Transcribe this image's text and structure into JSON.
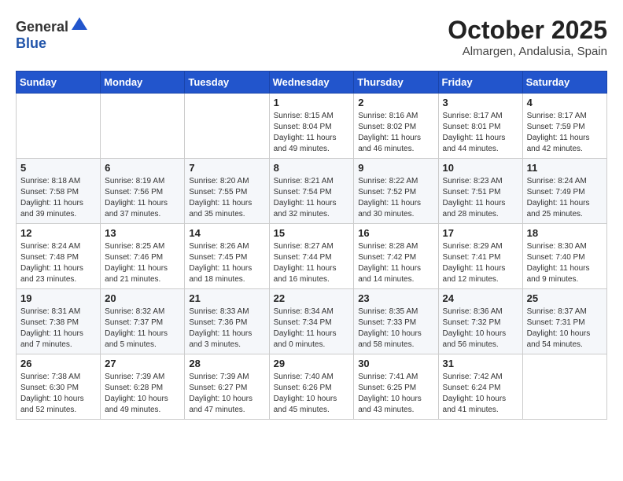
{
  "header": {
    "logo_general": "General",
    "logo_blue": "Blue",
    "month_title": "October 2025",
    "location": "Almargen, Andalusia, Spain"
  },
  "weekdays": [
    "Sunday",
    "Monday",
    "Tuesday",
    "Wednesday",
    "Thursday",
    "Friday",
    "Saturday"
  ],
  "weeks": [
    [
      {
        "day": "",
        "info": ""
      },
      {
        "day": "",
        "info": ""
      },
      {
        "day": "",
        "info": ""
      },
      {
        "day": "1",
        "info": "Sunrise: 8:15 AM\nSunset: 8:04 PM\nDaylight: 11 hours\nand 49 minutes."
      },
      {
        "day": "2",
        "info": "Sunrise: 8:16 AM\nSunset: 8:02 PM\nDaylight: 11 hours\nand 46 minutes."
      },
      {
        "day": "3",
        "info": "Sunrise: 8:17 AM\nSunset: 8:01 PM\nDaylight: 11 hours\nand 44 minutes."
      },
      {
        "day": "4",
        "info": "Sunrise: 8:17 AM\nSunset: 7:59 PM\nDaylight: 11 hours\nand 42 minutes."
      }
    ],
    [
      {
        "day": "5",
        "info": "Sunrise: 8:18 AM\nSunset: 7:58 PM\nDaylight: 11 hours\nand 39 minutes."
      },
      {
        "day": "6",
        "info": "Sunrise: 8:19 AM\nSunset: 7:56 PM\nDaylight: 11 hours\nand 37 minutes."
      },
      {
        "day": "7",
        "info": "Sunrise: 8:20 AM\nSunset: 7:55 PM\nDaylight: 11 hours\nand 35 minutes."
      },
      {
        "day": "8",
        "info": "Sunrise: 8:21 AM\nSunset: 7:54 PM\nDaylight: 11 hours\nand 32 minutes."
      },
      {
        "day": "9",
        "info": "Sunrise: 8:22 AM\nSunset: 7:52 PM\nDaylight: 11 hours\nand 30 minutes."
      },
      {
        "day": "10",
        "info": "Sunrise: 8:23 AM\nSunset: 7:51 PM\nDaylight: 11 hours\nand 28 minutes."
      },
      {
        "day": "11",
        "info": "Sunrise: 8:24 AM\nSunset: 7:49 PM\nDaylight: 11 hours\nand 25 minutes."
      }
    ],
    [
      {
        "day": "12",
        "info": "Sunrise: 8:24 AM\nSunset: 7:48 PM\nDaylight: 11 hours\nand 23 minutes."
      },
      {
        "day": "13",
        "info": "Sunrise: 8:25 AM\nSunset: 7:46 PM\nDaylight: 11 hours\nand 21 minutes."
      },
      {
        "day": "14",
        "info": "Sunrise: 8:26 AM\nSunset: 7:45 PM\nDaylight: 11 hours\nand 18 minutes."
      },
      {
        "day": "15",
        "info": "Sunrise: 8:27 AM\nSunset: 7:44 PM\nDaylight: 11 hours\nand 16 minutes."
      },
      {
        "day": "16",
        "info": "Sunrise: 8:28 AM\nSunset: 7:42 PM\nDaylight: 11 hours\nand 14 minutes."
      },
      {
        "day": "17",
        "info": "Sunrise: 8:29 AM\nSunset: 7:41 PM\nDaylight: 11 hours\nand 12 minutes."
      },
      {
        "day": "18",
        "info": "Sunrise: 8:30 AM\nSunset: 7:40 PM\nDaylight: 11 hours\nand 9 minutes."
      }
    ],
    [
      {
        "day": "19",
        "info": "Sunrise: 8:31 AM\nSunset: 7:38 PM\nDaylight: 11 hours\nand 7 minutes."
      },
      {
        "day": "20",
        "info": "Sunrise: 8:32 AM\nSunset: 7:37 PM\nDaylight: 11 hours\nand 5 minutes."
      },
      {
        "day": "21",
        "info": "Sunrise: 8:33 AM\nSunset: 7:36 PM\nDaylight: 11 hours\nand 3 minutes."
      },
      {
        "day": "22",
        "info": "Sunrise: 8:34 AM\nSunset: 7:34 PM\nDaylight: 11 hours\nand 0 minutes."
      },
      {
        "day": "23",
        "info": "Sunrise: 8:35 AM\nSunset: 7:33 PM\nDaylight: 10 hours\nand 58 minutes."
      },
      {
        "day": "24",
        "info": "Sunrise: 8:36 AM\nSunset: 7:32 PM\nDaylight: 10 hours\nand 56 minutes."
      },
      {
        "day": "25",
        "info": "Sunrise: 8:37 AM\nSunset: 7:31 PM\nDaylight: 10 hours\nand 54 minutes."
      }
    ],
    [
      {
        "day": "26",
        "info": "Sunrise: 7:38 AM\nSunset: 6:30 PM\nDaylight: 10 hours\nand 52 minutes."
      },
      {
        "day": "27",
        "info": "Sunrise: 7:39 AM\nSunset: 6:28 PM\nDaylight: 10 hours\nand 49 minutes."
      },
      {
        "day": "28",
        "info": "Sunrise: 7:39 AM\nSunset: 6:27 PM\nDaylight: 10 hours\nand 47 minutes."
      },
      {
        "day": "29",
        "info": "Sunrise: 7:40 AM\nSunset: 6:26 PM\nDaylight: 10 hours\nand 45 minutes."
      },
      {
        "day": "30",
        "info": "Sunrise: 7:41 AM\nSunset: 6:25 PM\nDaylight: 10 hours\nand 43 minutes."
      },
      {
        "day": "31",
        "info": "Sunrise: 7:42 AM\nSunset: 6:24 PM\nDaylight: 10 hours\nand 41 minutes."
      },
      {
        "day": "",
        "info": ""
      }
    ]
  ]
}
